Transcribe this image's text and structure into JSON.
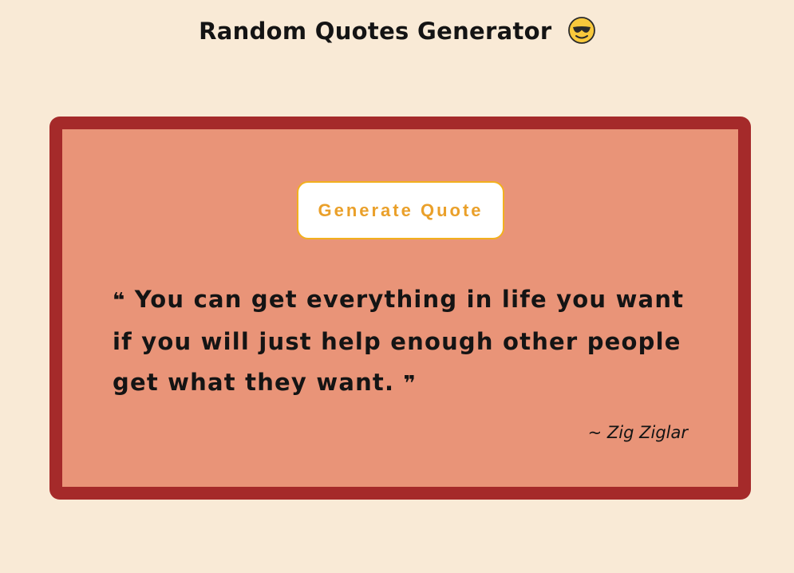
{
  "header": {
    "title": "Random Quotes Generator",
    "emoji_icon": "smiling-face-with-sunglasses-icon"
  },
  "card": {
    "button_label": "Generate Quote",
    "quote": {
      "open_mark": "❝",
      "text": "You can get everything in life you want if you will just help enough other people get what they want.",
      "close_mark": "❞"
    },
    "author": "~ Zig Ziglar"
  },
  "colors": {
    "page_background": "#f9ead6",
    "card_background": "#e99478",
    "card_border": "#a52a2a",
    "button_text": "#eaa02a",
    "button_border": "#f2b01e"
  }
}
